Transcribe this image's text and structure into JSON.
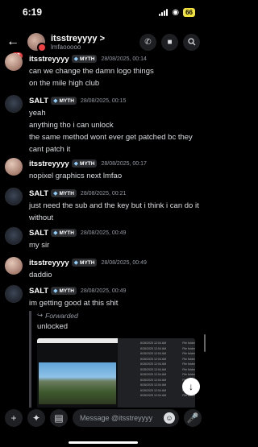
{
  "status": {
    "time": "6:19",
    "battery": "66"
  },
  "header": {
    "back_badge": "23",
    "title": "itsstreyyyy",
    "chevron": ">",
    "subtitle": "lmfaooooo"
  },
  "messages": [
    {
      "author": "itsstreyyyy",
      "tag": "MYTH",
      "time": "28/08/2025, 00:14",
      "lines": [
        "can we change the damn logo things",
        "on the mile high club"
      ],
      "avatar": "itsstreyyyy"
    },
    {
      "author": "SALT",
      "tag": "MYTH",
      "time": "28/08/2025, 00:15",
      "lines": [
        "yeah",
        "anything tho i can unlock",
        "the same method wont ever get patched bc they",
        "cant patch it"
      ],
      "avatar": "salt"
    },
    {
      "author": "itsstreyyyy",
      "tag": "MYTH",
      "time": "28/08/2025, 00:17",
      "lines": [
        "nopixel graphics next lmfao"
      ],
      "avatar": "itsstreyyyy"
    },
    {
      "author": "SALT",
      "tag": "MYTH",
      "time": "28/08/2025, 00:21",
      "lines": [
        "just need the sub and the key but i think i can do it",
        "without"
      ],
      "avatar": "salt"
    },
    {
      "author": "SALT",
      "tag": "MYTH",
      "time": "28/08/2025, 00:49",
      "lines": [
        "my sir"
      ],
      "avatar": "salt"
    },
    {
      "author": "itsstreyyyy",
      "tag": "MYTH",
      "time": "28/08/2025, 00:49",
      "lines": [
        "daddio"
      ],
      "avatar": "itsstreyyyy"
    },
    {
      "author": "SALT",
      "tag": "MYTH",
      "time": "28/08/2025, 00:49",
      "lines": [
        "im getting good at this shit"
      ],
      "avatar": "salt"
    }
  ],
  "forward": {
    "label": "Forwarded",
    "text": "unlocked"
  },
  "attachment": {
    "rows": [
      [
        "8/28/2025 12:04 AM",
        "File folder"
      ],
      [
        "8/28/2025 12:04 AM",
        "File folder"
      ],
      [
        "8/28/2025 12:04 AM",
        "File folder"
      ],
      [
        "8/28/2025 12:04 AM",
        "File folder"
      ],
      [
        "8/28/2025 12:04 AM",
        "File folder"
      ],
      [
        "8/28/2025 12:04 AM",
        "File folder"
      ],
      [
        "8/28/2025 12:04 AM",
        "File folder"
      ],
      [
        "8/28/2025 12:04 AM",
        "File folder"
      ],
      [
        "8/28/2025 12:04 AM",
        "File folder"
      ],
      [
        "8/28/2025 12:04 AM",
        "File folder"
      ],
      [
        "8/28/2025 12:04 AM",
        "File folder"
      ]
    ]
  },
  "composer": {
    "placeholder": "Message @itsstreyyyy"
  }
}
